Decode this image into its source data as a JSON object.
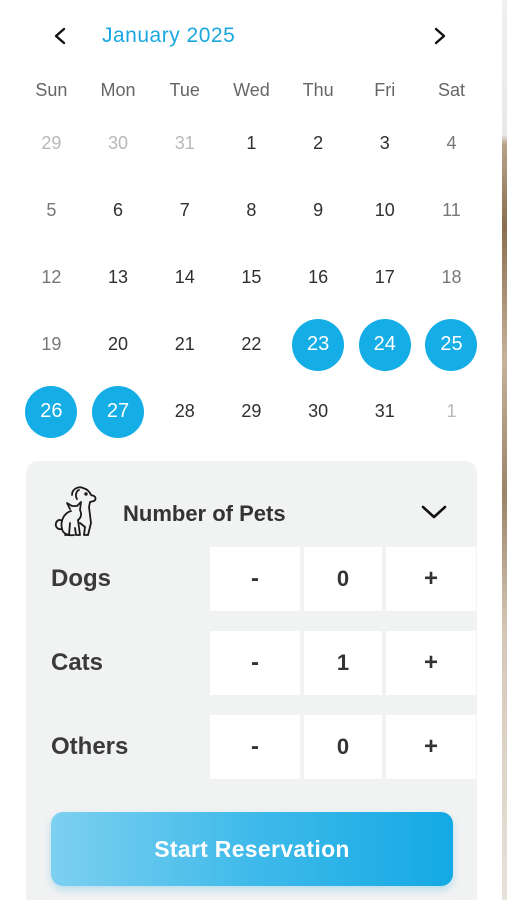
{
  "calendar": {
    "month_title": "January 2025",
    "weekdays": [
      "Sun",
      "Mon",
      "Tue",
      "Wed",
      "Thu",
      "Fri",
      "Sat"
    ],
    "weeks": [
      [
        {
          "d": "29",
          "s": "muted"
        },
        {
          "d": "30",
          "s": "muted"
        },
        {
          "d": "31",
          "s": "muted"
        },
        {
          "d": "1",
          "s": ""
        },
        {
          "d": "2",
          "s": ""
        },
        {
          "d": "3",
          "s": ""
        },
        {
          "d": "4",
          "s": "weekend"
        }
      ],
      [
        {
          "d": "5",
          "s": "weekend"
        },
        {
          "d": "6",
          "s": ""
        },
        {
          "d": "7",
          "s": ""
        },
        {
          "d": "8",
          "s": ""
        },
        {
          "d": "9",
          "s": ""
        },
        {
          "d": "10",
          "s": ""
        },
        {
          "d": "11",
          "s": "weekend"
        }
      ],
      [
        {
          "d": "12",
          "s": "weekend"
        },
        {
          "d": "13",
          "s": ""
        },
        {
          "d": "14",
          "s": ""
        },
        {
          "d": "15",
          "s": ""
        },
        {
          "d": "16",
          "s": ""
        },
        {
          "d": "17",
          "s": ""
        },
        {
          "d": "18",
          "s": "weekend"
        }
      ],
      [
        {
          "d": "19",
          "s": "weekend"
        },
        {
          "d": "20",
          "s": ""
        },
        {
          "d": "21",
          "s": ""
        },
        {
          "d": "22",
          "s": ""
        },
        {
          "d": "23",
          "s": "selected"
        },
        {
          "d": "24",
          "s": "selected"
        },
        {
          "d": "25",
          "s": "selected"
        }
      ],
      [
        {
          "d": "26",
          "s": "selected"
        },
        {
          "d": "27",
          "s": "selected"
        },
        {
          "d": "28",
          "s": ""
        },
        {
          "d": "29",
          "s": ""
        },
        {
          "d": "30",
          "s": ""
        },
        {
          "d": "31",
          "s": ""
        },
        {
          "d": "1",
          "s": "muted"
        }
      ]
    ],
    "prev_icon": "chevron-left-icon",
    "next_icon": "chevron-right-icon"
  },
  "pets": {
    "title": "Number of Pets",
    "icon": "pets-icon",
    "toggle_icon": "chevron-down-icon",
    "rows": [
      {
        "label": "Dogs",
        "minus": "-",
        "value": "0",
        "plus": "+"
      },
      {
        "label": "Cats",
        "minus": "-",
        "value": "1",
        "plus": "+"
      },
      {
        "label": "Others",
        "minus": "-",
        "value": "0",
        "plus": "+"
      }
    ],
    "reserve_label": "Start Reservation"
  },
  "colors": {
    "accent": "#14ade6",
    "panel_bg": "#f1f2f2"
  }
}
